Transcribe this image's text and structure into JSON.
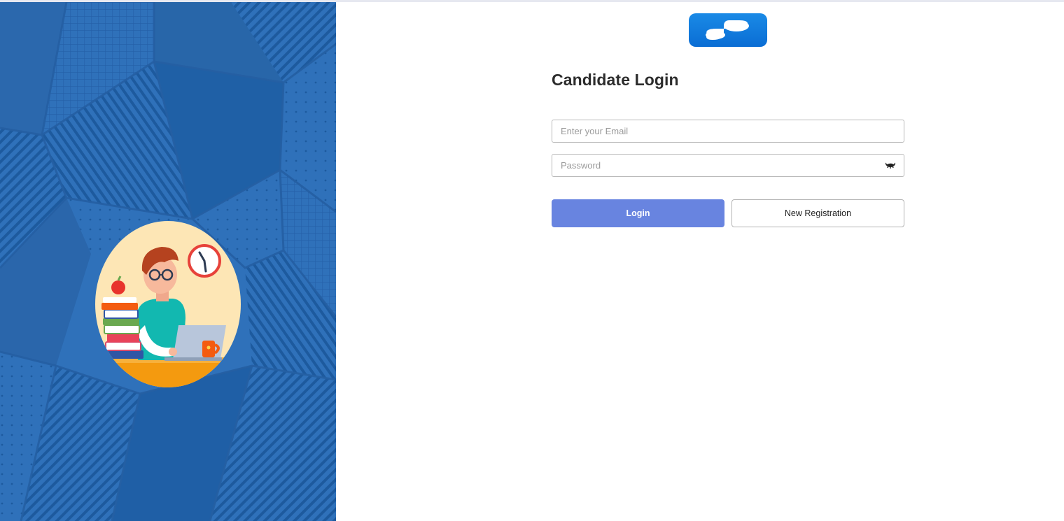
{
  "login_form": {
    "title": "Candidate Login",
    "email_placeholder": "Enter your Email",
    "email_value": "",
    "password_placeholder": "Password",
    "password_value": "",
    "login_label": "Login",
    "register_label": "New Registration"
  },
  "icons": {
    "logo": "brand-logo",
    "password_toggle": "eye-closed-icon",
    "illustration": "student-studying-illustration"
  },
  "colors": {
    "left_panel": "#2a6ab3",
    "login_button": "#6884e0",
    "logo": "#0a6dd4",
    "title_text": "#2c2c2c"
  }
}
